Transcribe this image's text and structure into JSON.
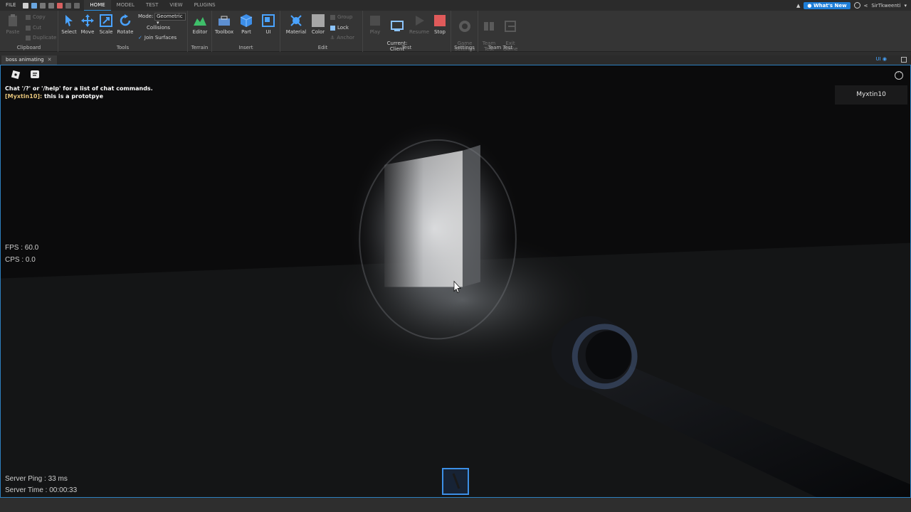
{
  "menubar": {
    "file": "FILE",
    "tabs": [
      "HOME",
      "MODEL",
      "TEST",
      "VIEW",
      "PLUGINS"
    ],
    "active_tab": "HOME",
    "whats_new": "What's New",
    "username": "SirTkweenti"
  },
  "ribbon": {
    "clipboard": {
      "paste": "Paste",
      "copy": "Copy",
      "cut": "Cut",
      "duplicate": "Duplicate",
      "label": "Clipboard"
    },
    "tools": {
      "select": "Select",
      "move": "Move",
      "scale": "Scale",
      "rotate": "Rotate",
      "label": "Tools",
      "mode_label": "Mode:",
      "mode_value": "Geometric",
      "collisions": "Collisions",
      "join_surfaces": "Join Surfaces"
    },
    "terrain": {
      "editor": "Editor",
      "label": "Terrain"
    },
    "insert": {
      "toolbox": "Toolbox",
      "part": "Part",
      "ui": "UI",
      "label": "Insert"
    },
    "edit": {
      "material": "Material",
      "color": "Color",
      "group": "Group",
      "lock": "Lock",
      "anchor": "Anchor",
      "label": "Edit"
    },
    "test": {
      "play": "Play",
      "current_client": "Current:\nClient",
      "resume": "Resume",
      "stop": "Stop",
      "label": "Test"
    },
    "settings": {
      "game_settings": "Game\nSettings",
      "label": "Settings"
    },
    "team_test": {
      "team_test": "Team\nTest",
      "exit_game": "Exit\nGame",
      "label": "Team Test"
    }
  },
  "document": {
    "tab_title": "boss animating",
    "ui_toggle": "UI"
  },
  "viewport": {
    "chat": {
      "system": "Chat '/?' or '/help' for a list of chat commands.",
      "speaker": "[Myxtin10]:",
      "message": " this is a prototpye"
    },
    "player_name": "Myxtin10",
    "fps": "FPS : 60.0",
    "cps": "CPS : 0.0",
    "server_ping": "Server Ping : 33 ms",
    "server_time": "Server Time : 00:00:33"
  },
  "colors": {
    "accent": "#2a8fe0",
    "whats_new_bg": "#1f7fd8",
    "stop_red": "#e05a5a",
    "viewport_border": "#2d7fbf"
  }
}
